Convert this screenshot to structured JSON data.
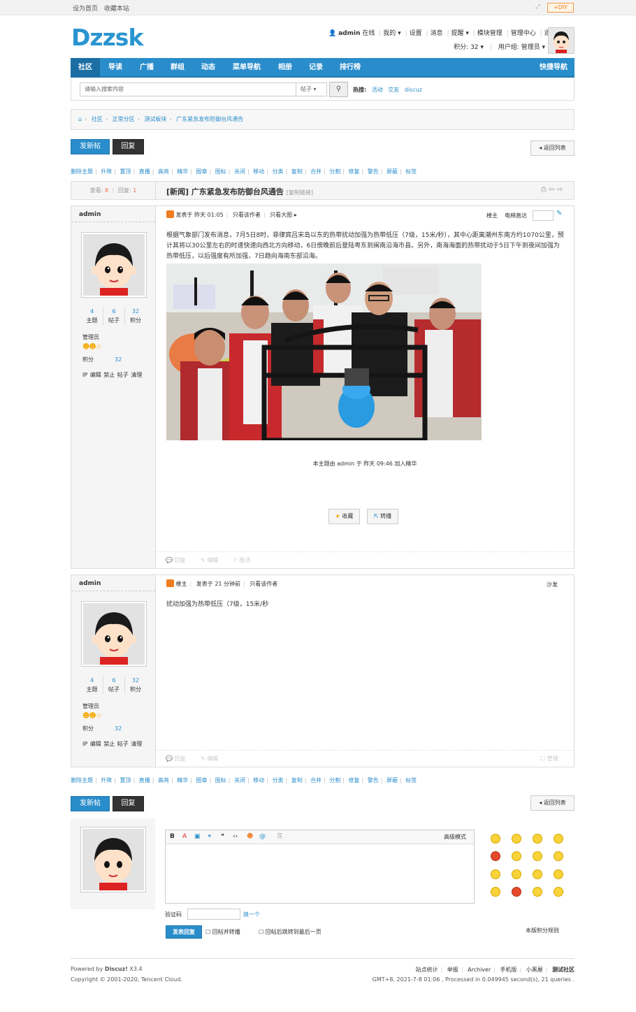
{
  "topbar": {
    "set_home": "设为首页",
    "bookmark": "收藏本站",
    "diy": "DIY"
  },
  "logo": "Dzzsk",
  "user": {
    "name": "admin",
    "status": "在线",
    "my": "我的",
    "settings": "设置",
    "messages": "消息",
    "reminders": "提醒",
    "module_mgmt": "模块管理",
    "admin_center": "管理中心",
    "logout": "退出",
    "points": "积分: 32",
    "usergroup": "用户组: 管理员"
  },
  "nav": {
    "items": [
      "社区",
      "导读",
      "广播",
      "群组",
      "动态",
      "菜单导航",
      "相册",
      "记录",
      "排行榜"
    ],
    "quick": "快捷导航"
  },
  "search": {
    "placeholder": "请输入搜索内容",
    "type": "帖子",
    "hot_label": "热搜:",
    "hot": [
      "活动",
      "交友",
      "discuz"
    ]
  },
  "breadcrumb": [
    "社区",
    "正常分区",
    "测试板块",
    "广东紧急发布防御台风通告"
  ],
  "buttons": {
    "new_post": "发新帖",
    "reply": "回复",
    "back_list": "返回列表"
  },
  "mod_actions": [
    "删除主题",
    "升降",
    "置顶",
    "直播",
    "高亮",
    "精华",
    "图章",
    "图标",
    "关闭",
    "移动",
    "分类",
    "复制",
    "合并",
    "分割",
    "修复",
    "警告",
    "屏蔽",
    "标签"
  ],
  "thread": {
    "views_label": "查看:",
    "views": "8",
    "replies_label": "回复:",
    "replies": "1",
    "title": "[新闻] 广东紧急发布防御台风通告",
    "copy_link": "[复制链接]"
  },
  "post1": {
    "author": "admin",
    "stats": [
      {
        "n": "4",
        "label": "主题"
      },
      {
        "n": "6",
        "label": "帖子"
      },
      {
        "n": "32",
        "label": "积分"
      }
    ],
    "group": "管理员",
    "jf_label": "积分",
    "jf": "32",
    "ops": "IP 编辑 禁止 帖子 清理",
    "meta_time": "发表于 昨天 01:05",
    "only_author": "只看该作者",
    "only_big": "只看大图",
    "floor": "楼主",
    "jump": "电梯直达",
    "body": "根据气象部门发布消息，7月5日8时，菲律宾吕宋岛以东的热带扰动加强为热带低压（7级，15米/秒），其中心距离潮州东南方约1070公里，预计其将以30公里左右的时速快速向西北方向移动，6日傍晚前后登陆粤东到闽南沿海市县。另外，南海海面的热带扰动于5日下午到夜间加强为热带低压，以后强度有所加强，7日趋向海南东部沿海。",
    "notice": "本主题由 admin 于 昨天 09:46 加入精华",
    "fav": "收藏",
    "share": "转播",
    "foot": [
      "回复",
      "编辑",
      "推送"
    ]
  },
  "post2": {
    "author": "admin",
    "stats": [
      {
        "n": "4",
        "label": "主题"
      },
      {
        "n": "6",
        "label": "帖子"
      },
      {
        "n": "32",
        "label": "积分"
      }
    ],
    "group": "管理员",
    "jf_label": "积分",
    "jf": "32",
    "ops": "IP 编辑 禁止 帖子 清理",
    "floor": "楼主",
    "meta_time": "发表于 21 分钟前",
    "only_author": "只看该作者",
    "sofa": "沙发",
    "body": "扰动加强为热带低压（7级，15米/秒",
    "foot": [
      "回复",
      "编辑"
    ],
    "manage": "管理"
  },
  "reply_form": {
    "advanced": "高级模式",
    "captcha_label": "验证码",
    "captcha_change": "换一个",
    "submit": "发表回复",
    "opt1": "回帖并转播",
    "opt2": "回帖后跳转到最后一页",
    "rules": "本版积分规则"
  },
  "footer": {
    "powered": "Powered by",
    "brand": "Discuz!",
    "version": "X3.4",
    "copyright": "Copyright © 2001-2020, Tencent Cloud.",
    "links": [
      "站点统计",
      "举报",
      "Archiver",
      "手机版",
      "小黑屋",
      "测试社区"
    ],
    "stats": "GMT+8, 2021-7-8 01:06 , Processed in 0.049945 second(s), 21 queries ."
  }
}
